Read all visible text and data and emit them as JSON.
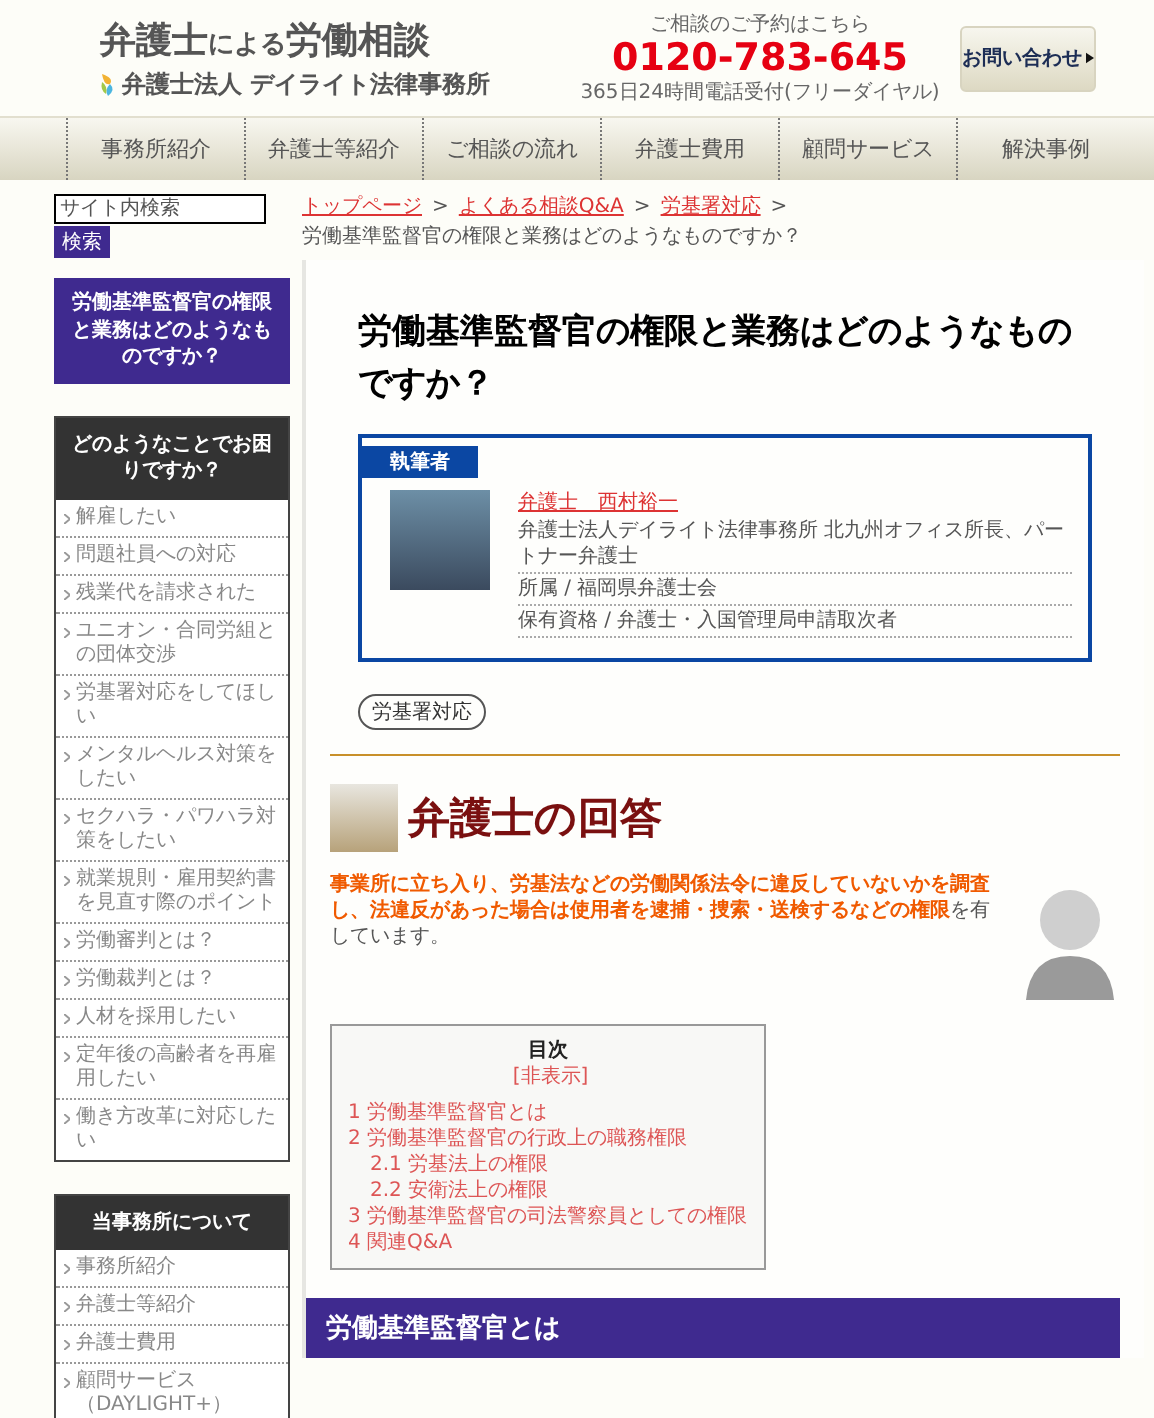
{
  "header": {
    "title_parts": [
      {
        "text": "弁護士",
        "emphasis": true
      },
      {
        "text": "による",
        "emphasis": false
      },
      {
        "text": "労働相談",
        "emphasis": true
      }
    ],
    "firm": "弁護士法人 デイライト法律事務所",
    "phone_caption": "ご相談のご予約はこちら",
    "phone": "0120-783-645",
    "phone_note": "365日24時間電話受付(フリーダイヤル)",
    "contact_button": "お問い合わせ"
  },
  "nav": [
    "事務所紹介",
    "弁護士等紹介",
    "ご相談の流れ",
    "弁護士費用",
    "顧問サービス",
    "解決事例"
  ],
  "search": {
    "placeholder": "サイト内検索",
    "button": "検索"
  },
  "sidebar": {
    "current_page": "労働基準監督官の権限と業務はどのようなものですか？",
    "panels": [
      {
        "title": "どのようなことでお困りですか？",
        "items": [
          "解雇したい",
          "問題社員への対応",
          "残業代を請求された",
          "ユニオン・合同労組との団体交渉",
          "労基署対応をしてほしい",
          "メンタルヘルス対策をしたい",
          "セクハラ・パワハラ対策をしたい",
          "就業規則・雇用契約書を見直す際のポイント",
          "労働審判とは？",
          "労働裁判とは？",
          "人材を採用したい",
          "定年後の高齢者を再雇用したい",
          "働き方改革に対応したい"
        ]
      },
      {
        "title": "当事務所について",
        "items": [
          "事務所紹介",
          "弁護士等紹介",
          "弁護士費用",
          "顧問サービス（DAYLIGHT+）"
        ]
      }
    ]
  },
  "breadcrumb": {
    "separator": ">",
    "items": [
      {
        "label": "トップページ",
        "link": true
      },
      {
        "label": "よくある相談Q&A",
        "link": true
      },
      {
        "label": "労基署対応",
        "link": true
      },
      {
        "label": "労働基準監督官の権限と業務はどのようなものですか？",
        "link": false
      }
    ]
  },
  "article": {
    "title": "労働基準監督官の権限と業務はどのようなものですか？",
    "author": {
      "label": "執筆者",
      "name": "弁護士　西村裕一",
      "lines": [
        "弁護士法人デイライト法律事務所 北九州オフィス所長、パートナー弁護士",
        "所属 / 福岡県弁護士会",
        "保有資格 / 弁護士・入国管理局申請取次者"
      ]
    },
    "tags": [
      "労基署対応"
    ],
    "answer_heading": "弁護士の回答",
    "answer": "**事業所に立ち入り、労基法などの労働関係法令に違反していないかを調査し、法違反があった場合は使用者を逮捕・捜索・送検するなどの権限**を有しています。",
    "toc": {
      "title": "目次",
      "toggle": "[非表示]",
      "items": [
        {
          "number": "1",
          "label": "労働基準監督官とは"
        },
        {
          "number": "2",
          "label": "労働基準監督官の行政上の職務権限",
          "children": [
            {
              "number": "2.1",
              "label": "労基法上の権限"
            },
            {
              "number": "2.2",
              "label": "安衛法上の権限"
            }
          ]
        },
        {
          "number": "3",
          "label": "労働基準監督官の司法警察員としての権限"
        },
        {
          "number": "4",
          "label": "関連Q&A"
        }
      ]
    },
    "section_heading": "労働基準監督官とは"
  }
}
